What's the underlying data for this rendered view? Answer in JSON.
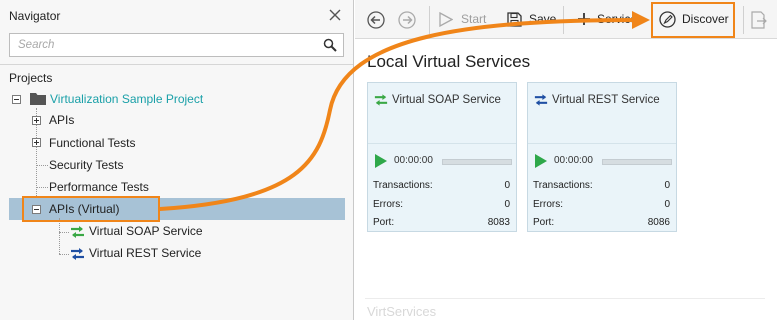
{
  "navigator": {
    "title": "Navigator",
    "search_placeholder": "Search",
    "projects_label": "Projects",
    "tree": {
      "project": "Virtualization Sample Project",
      "items": [
        {
          "label": "APIs"
        },
        {
          "label": "Functional Tests"
        },
        {
          "label": "Security Tests"
        },
        {
          "label": "Performance Tests"
        },
        {
          "label": "APIs (Virtual)"
        }
      ],
      "virtual_children": [
        {
          "label": "Virtual SOAP Service"
        },
        {
          "label": "Virtual REST Service"
        }
      ]
    }
  },
  "toolbar": {
    "start_label": "Start",
    "save_label": "Save",
    "service_label": "Service",
    "discover_label": "Discover"
  },
  "main": {
    "section_title": "Local Virtual Services",
    "cards": [
      {
        "title": "Virtual SOAP Service",
        "time": "00:00:00",
        "transactions_label": "Transactions:",
        "transactions": "0",
        "errors_label": "Errors:",
        "errors": "0",
        "port_label": "Port:",
        "port": "8083"
      },
      {
        "title": "Virtual REST Service",
        "time": "00:00:00",
        "transactions_label": "Transactions:",
        "transactions": "0",
        "errors_label": "Errors:",
        "errors": "0",
        "port_label": "Port:",
        "port": "8086"
      }
    ],
    "faint_text": "VirtServices"
  },
  "colors": {
    "accent_orange": "#f08519",
    "project_teal": "#1aa0a8",
    "selection": "#a7c2d6",
    "play_green": "#2ea84a",
    "card_bg": "#eaf4f9"
  },
  "icons": [
    "close-icon",
    "search-icon",
    "folder-icon",
    "back-icon",
    "forward-icon",
    "start-icon",
    "save-icon",
    "plus-icon",
    "discover-icon",
    "soap-service-icon",
    "rest-service-icon",
    "play-icon"
  ]
}
